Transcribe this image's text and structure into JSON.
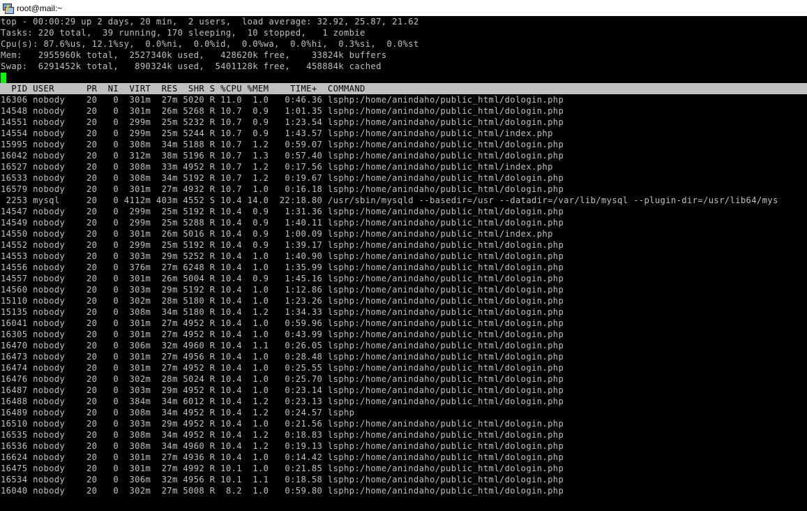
{
  "window": {
    "title": "root@mail:~",
    "icon": "putty-terminal-icon"
  },
  "summary": [
    "top - 00:00:29 up 2 days, 20 min,  2 users,  load average: 32.92, 25.87, 21.62",
    "Tasks: 220 total,  39 running, 170 sleeping,  10 stopped,   1 zombie",
    "Cpu(s): 87.6%us, 12.1%sy,  0.0%ni,  0.0%id,  0.0%wa,  0.0%hi,  0.3%si,  0.0%st",
    "Mem:   2955960k total,  2527340k used,   428620k free,    33824k buffers",
    "Swap:  6291452k total,   890324k used,  5401128k free,   458884k cached"
  ],
  "table": {
    "header": "  PID USER      PR  NI  VIRT  RES  SHR S %CPU %MEM    TIME+  COMMAND",
    "rows": [
      "16306 nobody    20   0  301m  27m 5020 R 11.0  1.0   0:46.36 lsphp:/home/anindaho/public_html/dologin.php",
      "14548 nobody    20   0  301m  26m 5268 R 10.7  0.9   1:01.35 lsphp:/home/anindaho/public_html/dologin.php",
      "14551 nobody    20   0  299m  25m 5232 R 10.7  0.9   1:23.54 lsphp:/home/anindaho/public_html/dologin.php",
      "14554 nobody    20   0  299m  25m 5244 R 10.7  0.9   1:43.57 lsphp:/home/anindaho/public_html/index.php",
      "15995 nobody    20   0  308m  34m 5188 R 10.7  1.2   0:59.07 lsphp:/home/anindaho/public_html/dologin.php",
      "16042 nobody    20   0  312m  38m 5196 R 10.7  1.3   0:57.40 lsphp:/home/anindaho/public_html/dologin.php",
      "16527 nobody    20   0  308m  33m 4952 R 10.7  1.2   0:17.56 lsphp:/home/anindaho/public_html/index.php",
      "16533 nobody    20   0  308m  34m 5192 R 10.7  1.2   0:19.67 lsphp:/home/anindaho/public_html/dologin.php",
      "16579 nobody    20   0  301m  27m 4932 R 10.7  1.0   0:16.18 lsphp:/home/anindaho/public_html/dologin.php",
      " 2253 mysql     20   0 4112m 403m 4552 S 10.4 14.0  22:18.80 /usr/sbin/mysqld --basedir=/usr --datadir=/var/lib/mysql --plugin-dir=/usr/lib64/mys",
      "14547 nobody    20   0  299m  25m 5192 R 10.4  0.9   1:31.36 lsphp:/home/anindaho/public_html/dologin.php",
      "14549 nobody    20   0  299m  25m 5288 R 10.4  0.9   1:40.11 lsphp:/home/anindaho/public_html/dologin.php",
      "14550 nobody    20   0  301m  26m 5016 R 10.4  0.9   1:00.09 lsphp:/home/anindaho/public_html/index.php",
      "14552 nobody    20   0  299m  25m 5192 R 10.4  0.9   1:39.17 lsphp:/home/anindaho/public_html/dologin.php",
      "14553 nobody    20   0  303m  29m 5252 R 10.4  1.0   1:40.90 lsphp:/home/anindaho/public_html/dologin.php",
      "14556 nobody    20   0  376m  27m 6248 R 10.4  1.0   1:35.99 lsphp:/home/anindaho/public_html/dologin.php",
      "14557 nobody    20   0  301m  26m 5004 R 10.4  0.9   1:45.16 lsphp:/home/anindaho/public_html/dologin.php",
      "14560 nobody    20   0  303m  29m 5192 R 10.4  1.0   1:12.86 lsphp:/home/anindaho/public_html/dologin.php",
      "15110 nobody    20   0  302m  28m 5180 R 10.4  1.0   1:23.26 lsphp:/home/anindaho/public_html/dologin.php",
      "15135 nobody    20   0  308m  34m 5180 R 10.4  1.2   1:34.33 lsphp:/home/anindaho/public_html/dologin.php",
      "16041 nobody    20   0  301m  27m 4952 R 10.4  1.0   0:59.96 lsphp:/home/anindaho/public_html/dologin.php",
      "16305 nobody    20   0  301m  27m 4952 R 10.4  1.0   0:43.99 lsphp:/home/anindaho/public_html/dologin.php",
      "16470 nobody    20   0  306m  32m 4960 R 10.4  1.1   0:26.05 lsphp:/home/anindaho/public_html/dologin.php",
      "16473 nobody    20   0  301m  27m 4956 R 10.4  1.0   0:28.48 lsphp:/home/anindaho/public_html/dologin.php",
      "16474 nobody    20   0  301m  27m 4952 R 10.4  1.0   0:25.55 lsphp:/home/anindaho/public_html/dologin.php",
      "16476 nobody    20   0  302m  28m 5024 R 10.4  1.0   0:25.70 lsphp:/home/anindaho/public_html/dologin.php",
      "16487 nobody    20   0  303m  29m 4952 R 10.4  1.0   0:23.14 lsphp:/home/anindaho/public_html/dologin.php",
      "16488 nobody    20   0  384m  34m 6012 R 10.4  1.2   0:23.13 lsphp:/home/anindaho/public_html/dologin.php",
      "16489 nobody    20   0  308m  34m 4952 R 10.4  1.2   0:24.57 lsphp",
      "16510 nobody    20   0  303m  29m 4952 R 10.4  1.0   0:21.56 lsphp:/home/anindaho/public_html/dologin.php",
      "16535 nobody    20   0  308m  34m 4952 R 10.4  1.2   0:18.83 lsphp:/home/anindaho/public_html/dologin.php",
      "16536 nobody    20   0  308m  34m 4960 R 10.4  1.2   0:19.13 lsphp:/home/anindaho/public_html/dologin.php",
      "16624 nobody    20   0  301m  27m 4936 R 10.4  1.0   0:14.42 lsphp:/home/anindaho/public_html/dologin.php",
      "16475 nobody    20   0  301m  27m 4992 R 10.1  1.0   0:21.85 lsphp:/home/anindaho/public_html/dologin.php",
      "16534 nobody    20   0  306m  32m 4956 R 10.1  1.1   0:18.58 lsphp:/home/anindaho/public_html/dologin.php",
      "16040 nobody    20   0  302m  27m 5008 R  8.2  1.0   0:59.80 lsphp:/home/anindaho/public_html/dologin.php"
    ]
  },
  "colors": {
    "terminal_bg": "#000000",
    "terminal_fg": "#c0c0c0",
    "header_bg": "#c0c0c0",
    "cursor": "#00ff00"
  }
}
